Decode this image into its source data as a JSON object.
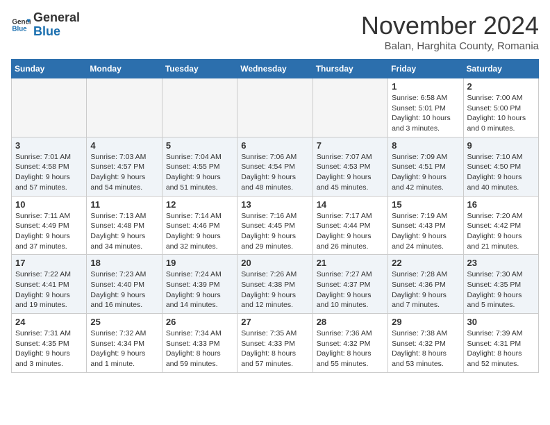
{
  "header": {
    "logo_line1": "General",
    "logo_line2": "Blue",
    "month_title": "November 2024",
    "subtitle": "Balan, Harghita County, Romania"
  },
  "weekdays": [
    "Sunday",
    "Monday",
    "Tuesday",
    "Wednesday",
    "Thursday",
    "Friday",
    "Saturday"
  ],
  "weeks": [
    [
      {
        "day": "",
        "info": ""
      },
      {
        "day": "",
        "info": ""
      },
      {
        "day": "",
        "info": ""
      },
      {
        "day": "",
        "info": ""
      },
      {
        "day": "",
        "info": ""
      },
      {
        "day": "1",
        "info": "Sunrise: 6:58 AM\nSunset: 5:01 PM\nDaylight: 10 hours\nand 3 minutes."
      },
      {
        "day": "2",
        "info": "Sunrise: 7:00 AM\nSunset: 5:00 PM\nDaylight: 10 hours\nand 0 minutes."
      }
    ],
    [
      {
        "day": "3",
        "info": "Sunrise: 7:01 AM\nSunset: 4:58 PM\nDaylight: 9 hours\nand 57 minutes."
      },
      {
        "day": "4",
        "info": "Sunrise: 7:03 AM\nSunset: 4:57 PM\nDaylight: 9 hours\nand 54 minutes."
      },
      {
        "day": "5",
        "info": "Sunrise: 7:04 AM\nSunset: 4:55 PM\nDaylight: 9 hours\nand 51 minutes."
      },
      {
        "day": "6",
        "info": "Sunrise: 7:06 AM\nSunset: 4:54 PM\nDaylight: 9 hours\nand 48 minutes."
      },
      {
        "day": "7",
        "info": "Sunrise: 7:07 AM\nSunset: 4:53 PM\nDaylight: 9 hours\nand 45 minutes."
      },
      {
        "day": "8",
        "info": "Sunrise: 7:09 AM\nSunset: 4:51 PM\nDaylight: 9 hours\nand 42 minutes."
      },
      {
        "day": "9",
        "info": "Sunrise: 7:10 AM\nSunset: 4:50 PM\nDaylight: 9 hours\nand 40 minutes."
      }
    ],
    [
      {
        "day": "10",
        "info": "Sunrise: 7:11 AM\nSunset: 4:49 PM\nDaylight: 9 hours\nand 37 minutes."
      },
      {
        "day": "11",
        "info": "Sunrise: 7:13 AM\nSunset: 4:48 PM\nDaylight: 9 hours\nand 34 minutes."
      },
      {
        "day": "12",
        "info": "Sunrise: 7:14 AM\nSunset: 4:46 PM\nDaylight: 9 hours\nand 32 minutes."
      },
      {
        "day": "13",
        "info": "Sunrise: 7:16 AM\nSunset: 4:45 PM\nDaylight: 9 hours\nand 29 minutes."
      },
      {
        "day": "14",
        "info": "Sunrise: 7:17 AM\nSunset: 4:44 PM\nDaylight: 9 hours\nand 26 minutes."
      },
      {
        "day": "15",
        "info": "Sunrise: 7:19 AM\nSunset: 4:43 PM\nDaylight: 9 hours\nand 24 minutes."
      },
      {
        "day": "16",
        "info": "Sunrise: 7:20 AM\nSunset: 4:42 PM\nDaylight: 9 hours\nand 21 minutes."
      }
    ],
    [
      {
        "day": "17",
        "info": "Sunrise: 7:22 AM\nSunset: 4:41 PM\nDaylight: 9 hours\nand 19 minutes."
      },
      {
        "day": "18",
        "info": "Sunrise: 7:23 AM\nSunset: 4:40 PM\nDaylight: 9 hours\nand 16 minutes."
      },
      {
        "day": "19",
        "info": "Sunrise: 7:24 AM\nSunset: 4:39 PM\nDaylight: 9 hours\nand 14 minutes."
      },
      {
        "day": "20",
        "info": "Sunrise: 7:26 AM\nSunset: 4:38 PM\nDaylight: 9 hours\nand 12 minutes."
      },
      {
        "day": "21",
        "info": "Sunrise: 7:27 AM\nSunset: 4:37 PM\nDaylight: 9 hours\nand 10 minutes."
      },
      {
        "day": "22",
        "info": "Sunrise: 7:28 AM\nSunset: 4:36 PM\nDaylight: 9 hours\nand 7 minutes."
      },
      {
        "day": "23",
        "info": "Sunrise: 7:30 AM\nSunset: 4:35 PM\nDaylight: 9 hours\nand 5 minutes."
      }
    ],
    [
      {
        "day": "24",
        "info": "Sunrise: 7:31 AM\nSunset: 4:35 PM\nDaylight: 9 hours\nand 3 minutes."
      },
      {
        "day": "25",
        "info": "Sunrise: 7:32 AM\nSunset: 4:34 PM\nDaylight: 9 hours\nand 1 minute."
      },
      {
        "day": "26",
        "info": "Sunrise: 7:34 AM\nSunset: 4:33 PM\nDaylight: 8 hours\nand 59 minutes."
      },
      {
        "day": "27",
        "info": "Sunrise: 7:35 AM\nSunset: 4:33 PM\nDaylight: 8 hours\nand 57 minutes."
      },
      {
        "day": "28",
        "info": "Sunrise: 7:36 AM\nSunset: 4:32 PM\nDaylight: 8 hours\nand 55 minutes."
      },
      {
        "day": "29",
        "info": "Sunrise: 7:38 AM\nSunset: 4:32 PM\nDaylight: 8 hours\nand 53 minutes."
      },
      {
        "day": "30",
        "info": "Sunrise: 7:39 AM\nSunset: 4:31 PM\nDaylight: 8 hours\nand 52 minutes."
      }
    ]
  ]
}
